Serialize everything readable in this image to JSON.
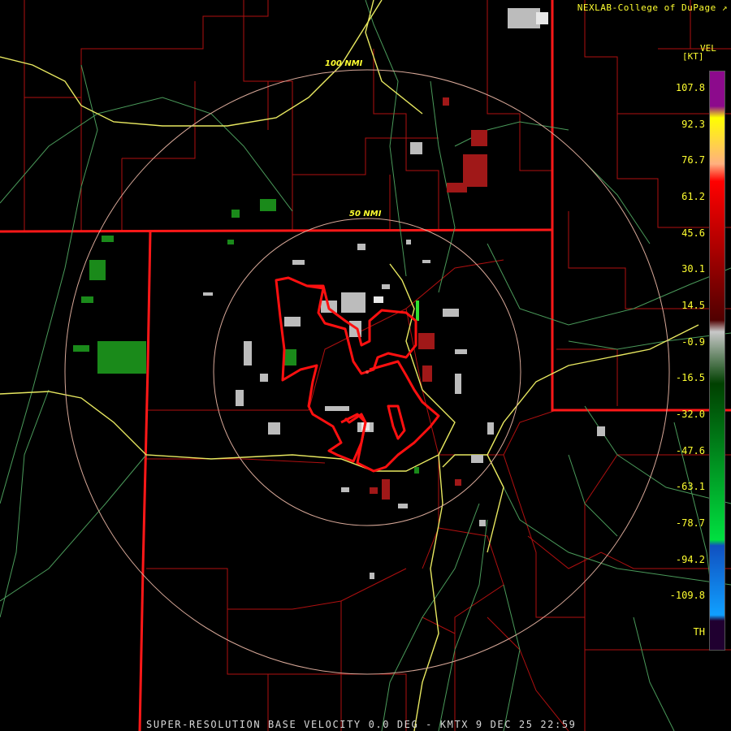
{
  "credit": "NEXLAB-College of DuPage",
  "legend": {
    "title": "VEL",
    "unit": "[KT]",
    "labels": [
      "107.8",
      "92.3",
      "76.7",
      "61.2",
      "45.6",
      "30.1",
      "14.5",
      "-0.9",
      "-16.5",
      "-32.0",
      "-47.6",
      "-63.1",
      "-78.7",
      "-94.2",
      "-109.8",
      "TH"
    ],
    "stops": [
      {
        "value": "107.8",
        "color": "#8c0a8c"
      },
      {
        "value": "92.3",
        "color": "#ffff00"
      },
      {
        "value": "76.7",
        "color": "#ffb080"
      },
      {
        "value": "61.2",
        "color": "#ff0000"
      },
      {
        "value": "30.1",
        "color": "#b00000"
      },
      {
        "value": "-0.9",
        "color": "#500000"
      },
      {
        "value": "-0.9",
        "color": "#c8c8c8"
      },
      {
        "value": "-16.5",
        "color": "#004000"
      },
      {
        "value": "-63.1",
        "color": "#00e040"
      },
      {
        "value": "-94.2",
        "color": "#1050c0"
      },
      {
        "value": "-109.8",
        "color": "#10a0ff"
      },
      {
        "value": "TH",
        "color": "#200030"
      }
    ]
  },
  "range_rings": [
    "50 NMI",
    "100 NMI"
  ],
  "caption": "SUPER-RESOLUTION BASE VELOCITY 0.0 DEG - KMTX 9 DEC 25 22:59",
  "colors": {
    "state_border": "#ff1010",
    "county_border": "#c01010",
    "highway": "#e0e060",
    "road": "#50a060",
    "range_ring": "#e0b0a0",
    "warning_polygon": "#ff0000"
  }
}
